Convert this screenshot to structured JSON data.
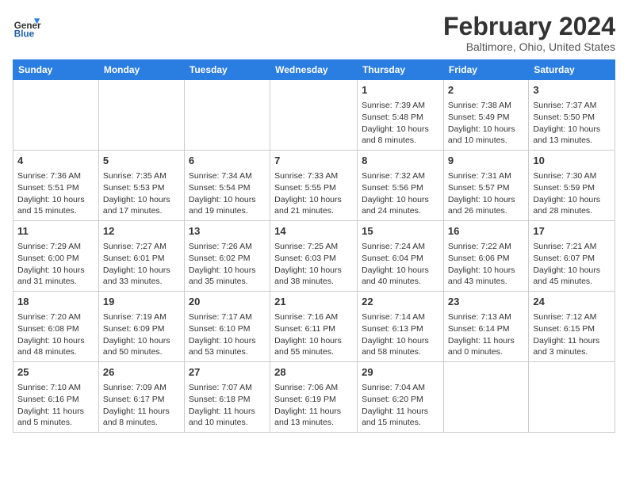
{
  "header": {
    "logo_general": "General",
    "logo_blue": "Blue",
    "title": "February 2024",
    "location": "Baltimore, Ohio, United States"
  },
  "days_of_week": [
    "Sunday",
    "Monday",
    "Tuesday",
    "Wednesday",
    "Thursday",
    "Friday",
    "Saturday"
  ],
  "weeks": [
    [
      {
        "day": "",
        "info": ""
      },
      {
        "day": "",
        "info": ""
      },
      {
        "day": "",
        "info": ""
      },
      {
        "day": "",
        "info": ""
      },
      {
        "day": "1",
        "info": "Sunrise: 7:39 AM\nSunset: 5:48 PM\nDaylight: 10 hours\nand 8 minutes."
      },
      {
        "day": "2",
        "info": "Sunrise: 7:38 AM\nSunset: 5:49 PM\nDaylight: 10 hours\nand 10 minutes."
      },
      {
        "day": "3",
        "info": "Sunrise: 7:37 AM\nSunset: 5:50 PM\nDaylight: 10 hours\nand 13 minutes."
      }
    ],
    [
      {
        "day": "4",
        "info": "Sunrise: 7:36 AM\nSunset: 5:51 PM\nDaylight: 10 hours\nand 15 minutes."
      },
      {
        "day": "5",
        "info": "Sunrise: 7:35 AM\nSunset: 5:53 PM\nDaylight: 10 hours\nand 17 minutes."
      },
      {
        "day": "6",
        "info": "Sunrise: 7:34 AM\nSunset: 5:54 PM\nDaylight: 10 hours\nand 19 minutes."
      },
      {
        "day": "7",
        "info": "Sunrise: 7:33 AM\nSunset: 5:55 PM\nDaylight: 10 hours\nand 21 minutes."
      },
      {
        "day": "8",
        "info": "Sunrise: 7:32 AM\nSunset: 5:56 PM\nDaylight: 10 hours\nand 24 minutes."
      },
      {
        "day": "9",
        "info": "Sunrise: 7:31 AM\nSunset: 5:57 PM\nDaylight: 10 hours\nand 26 minutes."
      },
      {
        "day": "10",
        "info": "Sunrise: 7:30 AM\nSunset: 5:59 PM\nDaylight: 10 hours\nand 28 minutes."
      }
    ],
    [
      {
        "day": "11",
        "info": "Sunrise: 7:29 AM\nSunset: 6:00 PM\nDaylight: 10 hours\nand 31 minutes."
      },
      {
        "day": "12",
        "info": "Sunrise: 7:27 AM\nSunset: 6:01 PM\nDaylight: 10 hours\nand 33 minutes."
      },
      {
        "day": "13",
        "info": "Sunrise: 7:26 AM\nSunset: 6:02 PM\nDaylight: 10 hours\nand 35 minutes."
      },
      {
        "day": "14",
        "info": "Sunrise: 7:25 AM\nSunset: 6:03 PM\nDaylight: 10 hours\nand 38 minutes."
      },
      {
        "day": "15",
        "info": "Sunrise: 7:24 AM\nSunset: 6:04 PM\nDaylight: 10 hours\nand 40 minutes."
      },
      {
        "day": "16",
        "info": "Sunrise: 7:22 AM\nSunset: 6:06 PM\nDaylight: 10 hours\nand 43 minutes."
      },
      {
        "day": "17",
        "info": "Sunrise: 7:21 AM\nSunset: 6:07 PM\nDaylight: 10 hours\nand 45 minutes."
      }
    ],
    [
      {
        "day": "18",
        "info": "Sunrise: 7:20 AM\nSunset: 6:08 PM\nDaylight: 10 hours\nand 48 minutes."
      },
      {
        "day": "19",
        "info": "Sunrise: 7:19 AM\nSunset: 6:09 PM\nDaylight: 10 hours\nand 50 minutes."
      },
      {
        "day": "20",
        "info": "Sunrise: 7:17 AM\nSunset: 6:10 PM\nDaylight: 10 hours\nand 53 minutes."
      },
      {
        "day": "21",
        "info": "Sunrise: 7:16 AM\nSunset: 6:11 PM\nDaylight: 10 hours\nand 55 minutes."
      },
      {
        "day": "22",
        "info": "Sunrise: 7:14 AM\nSunset: 6:13 PM\nDaylight: 10 hours\nand 58 minutes."
      },
      {
        "day": "23",
        "info": "Sunrise: 7:13 AM\nSunset: 6:14 PM\nDaylight: 11 hours\nand 0 minutes."
      },
      {
        "day": "24",
        "info": "Sunrise: 7:12 AM\nSunset: 6:15 PM\nDaylight: 11 hours\nand 3 minutes."
      }
    ],
    [
      {
        "day": "25",
        "info": "Sunrise: 7:10 AM\nSunset: 6:16 PM\nDaylight: 11 hours\nand 5 minutes."
      },
      {
        "day": "26",
        "info": "Sunrise: 7:09 AM\nSunset: 6:17 PM\nDaylight: 11 hours\nand 8 minutes."
      },
      {
        "day": "27",
        "info": "Sunrise: 7:07 AM\nSunset: 6:18 PM\nDaylight: 11 hours\nand 10 minutes."
      },
      {
        "day": "28",
        "info": "Sunrise: 7:06 AM\nSunset: 6:19 PM\nDaylight: 11 hours\nand 13 minutes."
      },
      {
        "day": "29",
        "info": "Sunrise: 7:04 AM\nSunset: 6:20 PM\nDaylight: 11 hours\nand 15 minutes."
      },
      {
        "day": "",
        "info": ""
      },
      {
        "day": "",
        "info": ""
      }
    ]
  ]
}
